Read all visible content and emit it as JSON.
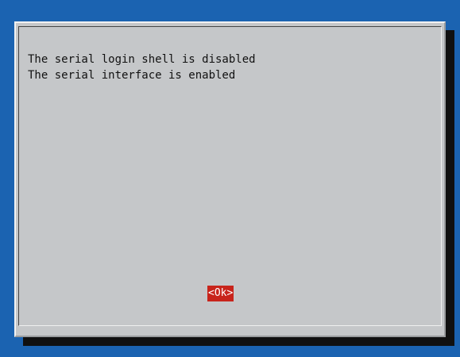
{
  "dialog": {
    "messages": [
      "The serial login shell is disabled",
      "The serial interface is enabled"
    ],
    "ok_label": "<Ok>"
  },
  "colors": {
    "background": "#1b63b1",
    "dialog": "#c5c7c9",
    "button_selected": "#c8241b",
    "button_text": "#ffffff"
  }
}
